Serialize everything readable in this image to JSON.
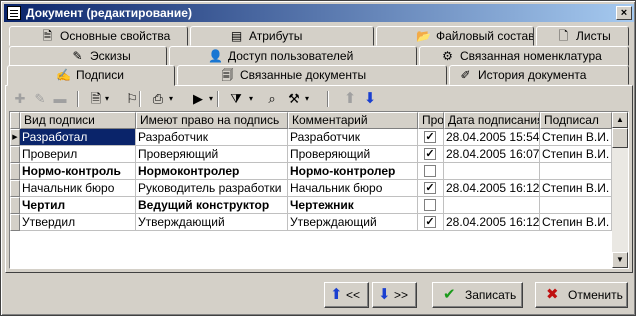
{
  "window": {
    "title": "Документ (редактирование)",
    "close_glyph": "×"
  },
  "tabs": {
    "row1": [
      {
        "label": "Основные свойства",
        "icon": "document-icon",
        "glyph": "🗎"
      },
      {
        "label": "Атрибуты",
        "icon": "attributes-icon",
        "glyph": "▤"
      },
      {
        "label": "Файловый состав",
        "icon": "folder-icon",
        "glyph": "📂"
      },
      {
        "label": "Листы",
        "icon": "sheet-icon",
        "glyph": "🗋"
      }
    ],
    "row2": [
      {
        "label": "Эскизы",
        "icon": "sketch-icon",
        "glyph": "✎"
      },
      {
        "label": "Доступ пользователей",
        "icon": "user-icon",
        "glyph": "👤"
      },
      {
        "label": "Связанная номенклатура",
        "icon": "nomenclature-icon",
        "glyph": "⚙"
      }
    ],
    "row3": [
      {
        "label": "Подписи",
        "icon": "signature-icon",
        "glyph": "✍",
        "active": true
      },
      {
        "label": "Связанные документы",
        "icon": "linked-docs-icon",
        "glyph": "🗐"
      },
      {
        "label": "История документа",
        "icon": "history-icon",
        "glyph": "✐"
      }
    ]
  },
  "toolbar": [
    {
      "icon": "add-icon",
      "glyph": "✚",
      "enabled": false
    },
    {
      "icon": "edit-icon",
      "glyph": "✎",
      "enabled": false
    },
    {
      "icon": "delete-icon",
      "glyph": "▬",
      "enabled": false
    },
    {
      "icon": "document-menu-icon",
      "glyph": "🗎",
      "enabled": true
    },
    {
      "icon": "sign-icon",
      "glyph": "⚐",
      "enabled": true
    },
    {
      "icon": "print-icon",
      "glyph": "⎙",
      "enabled": true
    },
    {
      "icon": "run-icon",
      "glyph": "▶",
      "enabled": true
    },
    {
      "icon": "filter-icon",
      "glyph": "⧩",
      "enabled": true
    },
    {
      "icon": "find-icon",
      "glyph": "⌕",
      "enabled": true
    },
    {
      "icon": "tools-icon",
      "glyph": "⚒",
      "enabled": true
    },
    {
      "icon": "move-up-icon",
      "glyph": "⬆",
      "enabled": false
    },
    {
      "icon": "move-down-icon",
      "glyph": "⬇",
      "enabled": true
    }
  ],
  "dropdown_glyph": "▾",
  "table": {
    "columns": [
      "Вид подписи",
      "Имеют право на подпись",
      "Комментарий",
      "Прост",
      "Дата подписания",
      "Подписал"
    ],
    "rows": [
      {
        "kind": "Разработал",
        "right": "Разработчик",
        "comment": "Разработчик",
        "simple": true,
        "date": "28.04.2005 15:54",
        "signed_by": "Степин В.И.",
        "bold": false,
        "selected": true
      },
      {
        "kind": "Проверил",
        "right": "Проверяющий",
        "comment": "Проверяющий",
        "simple": true,
        "date": "28.04.2005 16:07",
        "signed_by": "Степин В.И.",
        "bold": false,
        "selected": false
      },
      {
        "kind": "Нормо-контроль",
        "right": "Нормоконтролер",
        "comment": "Нормо-контролер",
        "simple": false,
        "date": "",
        "signed_by": "",
        "bold": true,
        "selected": false
      },
      {
        "kind": "Начальник бюро",
        "right": "Руководитель разработки",
        "comment": "Начальник бюро",
        "simple": true,
        "date": "28.04.2005 16:12",
        "signed_by": "Степин В.И.",
        "bold": false,
        "selected": false
      },
      {
        "kind": "Чертил",
        "right": "Ведущий конструктор",
        "comment": "Чертежник",
        "simple": false,
        "date": "",
        "signed_by": "",
        "bold": true,
        "selected": false
      },
      {
        "kind": "Утвердил",
        "right": "Утверждающий",
        "comment": "Утверждающий",
        "simple": true,
        "date": "28.04.2005 16:12",
        "signed_by": "Степин В.И.",
        "bold": false,
        "selected": false
      }
    ]
  },
  "buttons": {
    "prev": {
      "label": "<<",
      "icon": "arrow-up-icon",
      "glyph": "⬆"
    },
    "next": {
      "label": ">>",
      "icon": "arrow-down-icon",
      "glyph": "⬇"
    },
    "save": {
      "label": "Записать",
      "icon": "checkmark-icon",
      "glyph": "✔"
    },
    "cancel": {
      "label": "Отменить",
      "icon": "cancel-x-icon",
      "glyph": "✖"
    }
  },
  "colors": {
    "title_start": "#0a246a",
    "title_end": "#a6caf0",
    "selection": "#0a246a",
    "arrow_blue": "#1a3fd0",
    "save_green": "#1a9a1a",
    "cancel_red": "#c01010"
  }
}
